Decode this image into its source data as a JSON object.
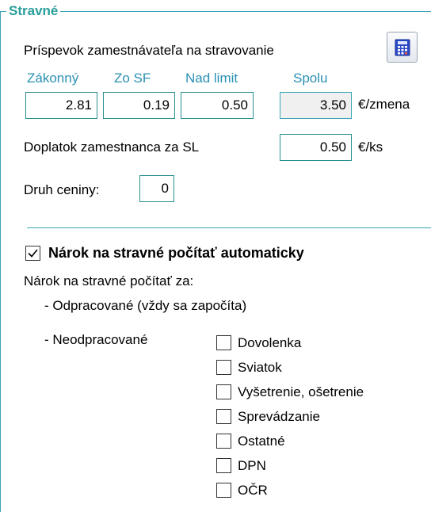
{
  "section": {
    "title": "Stravné"
  },
  "contribution": {
    "label": "Príspevok zamestnávateľa na stravovanie",
    "calculator_icon": "calculator-icon",
    "headers": {
      "legal": "Zákonný",
      "sf": "Zo SF",
      "over_limit": "Nad limit",
      "total": "Spolu"
    },
    "values": {
      "legal": "2.81",
      "sf": "0.19",
      "over_limit": "0.50",
      "total": "3.50"
    },
    "unit": "€/zmena"
  },
  "surcharge": {
    "label": "Doplatok zamestnanca za SL",
    "value": "0.50",
    "unit": "€/ks"
  },
  "voucher": {
    "label": "Druh ceniny:",
    "value": "0"
  },
  "auto_entitlement": {
    "label": "Nárok na stravné počítať automaticky",
    "checked": true
  },
  "entitlement": {
    "label": "Nárok na stravné počítať za:",
    "worked": "- Odpracované (vždy sa započíta)",
    "not_worked": "- Neodpracované",
    "options": [
      {
        "label": "Dovolenka",
        "checked": false
      },
      {
        "label": "Sviatok",
        "checked": false
      },
      {
        "label": "Vyšetrenie, ošetrenie",
        "checked": false
      },
      {
        "label": "Sprevádzanie",
        "checked": false
      },
      {
        "label": "Ostatné",
        "checked": false
      },
      {
        "label": "DPN",
        "checked": false
      },
      {
        "label": "OČR",
        "checked": false
      }
    ]
  },
  "colors": {
    "frame": "#3aa6b6",
    "title": "#2a9f9b",
    "column_header": "#2a90b3",
    "field_border": "#2a8f8f"
  }
}
